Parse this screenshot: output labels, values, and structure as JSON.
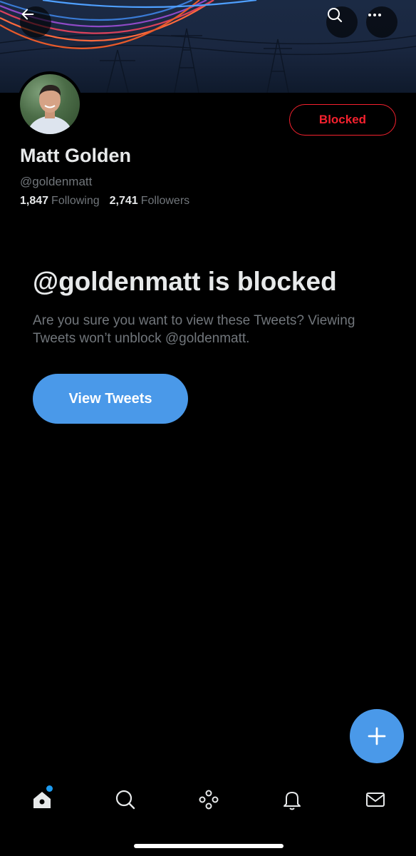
{
  "profile": {
    "name": "Matt Golden",
    "handle": "@goldenmatt",
    "following_count": "1,847",
    "following_label": "Following",
    "followers_count": "2,741",
    "followers_label": "Followers"
  },
  "header": {
    "back_icon": "arrow-left-icon",
    "search_icon": "search-icon",
    "more_icon": "more-icon"
  },
  "actions": {
    "blocked_label": "Blocked"
  },
  "blocked_notice": {
    "title": "@goldenmatt is blocked",
    "description": "Are you sure you want to view these Tweets? Viewing Tweets won’t unblock @goldenmatt.",
    "button_label": "View Tweets"
  },
  "tabbar": {
    "items": [
      "home-icon",
      "search-icon",
      "spaces-icon",
      "notifications-icon",
      "messages-icon"
    ]
  },
  "colors": {
    "accent": "#4a99e9",
    "blocked": "#f4212e",
    "background": "#000000"
  }
}
